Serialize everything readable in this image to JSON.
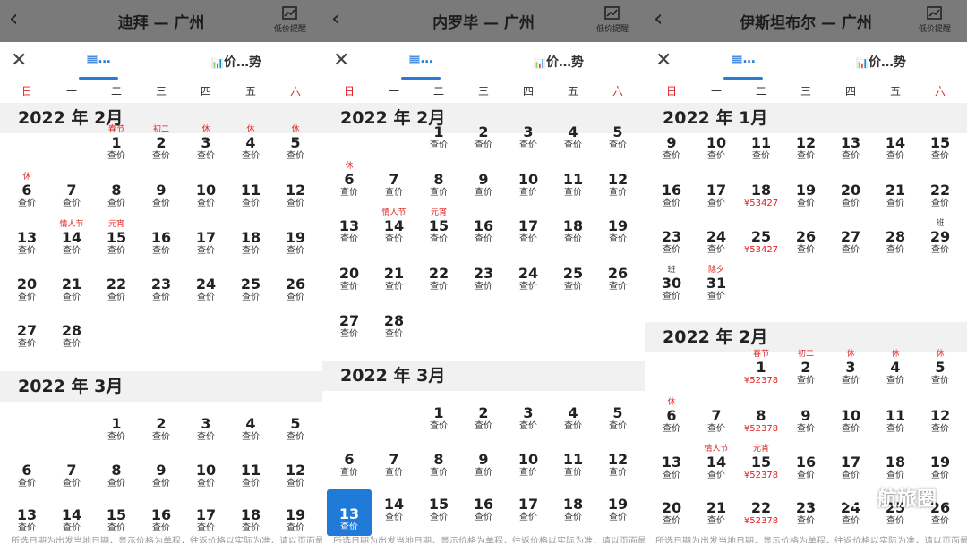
{
  "alert_label": "低价提醒",
  "tab_trend_label": "价…势",
  "weekdays": [
    "日",
    "一",
    "二",
    "三",
    "四",
    "五",
    "六"
  ],
  "footer_note": "所选日期为出发当地日期，显示价格为单程，往返价格以实际为准，请以页面最终价格为准",
  "watermark": "航旅圈",
  "panels": [
    {
      "route": "迪拜 — 广州",
      "months": [
        {
          "label": "2022 年 2月",
          "days": [
            {
              "d": "1",
              "hol": "春节",
              "p": "查价"
            },
            {
              "d": "2",
              "hol": "初二",
              "p": "查价"
            },
            {
              "d": "3",
              "hol": "休",
              "p": "查价"
            },
            {
              "d": "4",
              "hol": "休",
              "p": "查价"
            },
            {
              "d": "5",
              "hol": "休",
              "p": "查价"
            },
            {
              "d": "6",
              "hol": "休",
              "p": "查价"
            },
            {
              "d": "7",
              "p": "查价"
            },
            {
              "d": "8",
              "p": "查价"
            },
            {
              "d": "9",
              "p": "查价"
            },
            {
              "d": "10",
              "p": "查价"
            },
            {
              "d": "11",
              "p": "查价"
            },
            {
              "d": "12",
              "p": "查价"
            },
            {
              "d": "13",
              "p": "查价"
            },
            {
              "d": "14",
              "hol": "情人节",
              "p": "查价"
            },
            {
              "d": "15",
              "hol": "元宵",
              "p": "查价"
            },
            {
              "d": "16",
              "p": "查价"
            },
            {
              "d": "17",
              "p": "查价"
            },
            {
              "d": "18",
              "p": "查价"
            },
            {
              "d": "19",
              "p": "查价"
            },
            {
              "d": "20",
              "p": "查价"
            },
            {
              "d": "21",
              "p": "查价"
            },
            {
              "d": "22",
              "p": "查价"
            },
            {
              "d": "23",
              "p": "查价"
            },
            {
              "d": "24",
              "p": "查价"
            },
            {
              "d": "25",
              "p": "查价"
            },
            {
              "d": "26",
              "p": "查价"
            },
            {
              "d": "27",
              "p": "查价"
            },
            {
              "d": "28",
              "p": "查价"
            }
          ]
        },
        {
          "label": "2022 年 3月",
          "days": [
            {
              "d": "1",
              "p": "查价"
            },
            {
              "d": "2",
              "p": "查价"
            },
            {
              "d": "3",
              "p": "查价"
            },
            {
              "d": "4",
              "p": "查价"
            },
            {
              "d": "5",
              "p": "查价"
            },
            {
              "d": "6",
              "p": "查价"
            },
            {
              "d": "7",
              "p": "查价"
            },
            {
              "d": "8",
              "p": "查价"
            },
            {
              "d": "9",
              "p": "查价"
            },
            {
              "d": "10",
              "p": "查价"
            },
            {
              "d": "11",
              "p": "查价"
            },
            {
              "d": "12",
              "p": "查价"
            },
            {
              "d": "13",
              "p": "查价"
            },
            {
              "d": "14",
              "p": "查价"
            },
            {
              "d": "15",
              "p": "查价"
            },
            {
              "d": "16",
              "p": "查价"
            },
            {
              "d": "17",
              "p": "查价"
            },
            {
              "d": "18",
              "p": "查价"
            },
            {
              "d": "19",
              "p": "查价"
            }
          ]
        }
      ]
    },
    {
      "route": "内罗毕 — 广州",
      "months": [
        {
          "label": "2022 年 2月",
          "days": [
            {
              "d": "1",
              "p": "查价"
            },
            {
              "d": "2",
              "p": "查价"
            },
            {
              "d": "3",
              "p": "查价"
            },
            {
              "d": "4",
              "p": "查价"
            },
            {
              "d": "5",
              "p": "查价"
            },
            {
              "d": "6",
              "hol": "休",
              "p": "查价"
            },
            {
              "d": "7",
              "p": "查价"
            },
            {
              "d": "8",
              "p": "查价"
            },
            {
              "d": "9",
              "p": "查价"
            },
            {
              "d": "10",
              "p": "查价"
            },
            {
              "d": "11",
              "p": "查价"
            },
            {
              "d": "12",
              "p": "查价"
            },
            {
              "d": "13",
              "p": "查价"
            },
            {
              "d": "14",
              "hol": "情人节",
              "p": "查价"
            },
            {
              "d": "15",
              "hol": "元宵",
              "p": "查价"
            },
            {
              "d": "16",
              "p": "查价"
            },
            {
              "d": "17",
              "p": "查价"
            },
            {
              "d": "18",
              "p": "查价"
            },
            {
              "d": "19",
              "p": "查价"
            },
            {
              "d": "20",
              "p": "查价"
            },
            {
              "d": "21",
              "p": "查价"
            },
            {
              "d": "22",
              "p": "查价"
            },
            {
              "d": "23",
              "p": "查价"
            },
            {
              "d": "24",
              "p": "查价"
            },
            {
              "d": "25",
              "p": "查价"
            },
            {
              "d": "26",
              "p": "查价"
            },
            {
              "d": "27",
              "p": "查价"
            },
            {
              "d": "28",
              "p": "查价"
            }
          ]
        },
        {
          "label": "2022 年 3月",
          "days": [
            {
              "d": "1",
              "p": "查价"
            },
            {
              "d": "2",
              "p": "查价"
            },
            {
              "d": "3",
              "p": "查价"
            },
            {
              "d": "4",
              "p": "查价"
            },
            {
              "d": "5",
              "p": "查价"
            },
            {
              "d": "6",
              "p": "查价"
            },
            {
              "d": "7",
              "p": "查价"
            },
            {
              "d": "8",
              "p": "查价"
            },
            {
              "d": "9",
              "p": "查价"
            },
            {
              "d": "10",
              "p": "查价"
            },
            {
              "d": "11",
              "p": "查价"
            },
            {
              "d": "12",
              "p": "查价"
            },
            {
              "d": "13",
              "p": "查价",
              "selected": true
            },
            {
              "d": "14",
              "p": "查价"
            },
            {
              "d": "15",
              "p": "查价"
            },
            {
              "d": "16",
              "p": "查价"
            },
            {
              "d": "17",
              "p": "查价"
            },
            {
              "d": "18",
              "p": "查价"
            },
            {
              "d": "19",
              "p": "查价"
            }
          ]
        }
      ]
    },
    {
      "route": "伊斯坦布尔 — 广州",
      "months": [
        {
          "label": "2022 年 1月",
          "days": [
            {
              "d": "9",
              "p": "查价"
            },
            {
              "d": "10",
              "p": "查价"
            },
            {
              "d": "11",
              "p": "查价"
            },
            {
              "d": "12",
              "p": "查价"
            },
            {
              "d": "13",
              "p": "查价"
            },
            {
              "d": "14",
              "p": "查价"
            },
            {
              "d": "15",
              "p": "查价"
            },
            {
              "d": "16",
              "p": "查价"
            },
            {
              "d": "17",
              "p": "查价"
            },
            {
              "d": "18",
              "p": "¥53427",
              "red": true
            },
            {
              "d": "19",
              "p": "查价"
            },
            {
              "d": "20",
              "p": "查价"
            },
            {
              "d": "21",
              "p": "查价"
            },
            {
              "d": "22",
              "p": "查价"
            },
            {
              "d": "23",
              "p": "查价"
            },
            {
              "d": "24",
              "p": "查价"
            },
            {
              "d": "25",
              "p": "¥53427",
              "red": true
            },
            {
              "d": "26",
              "p": "查价"
            },
            {
              "d": "27",
              "p": "查价"
            },
            {
              "d": "28",
              "p": "查价"
            },
            {
              "d": "29",
              "hol": "班",
              "gray": true,
              "p": "查价"
            },
            {
              "d": "30",
              "hol": "班",
              "gray": true,
              "p": "查价"
            },
            {
              "d": "31",
              "hol": "除夕",
              "p": "查价"
            }
          ]
        },
        {
          "label": "2022 年 2月",
          "days": [
            {
              "d": "1",
              "hol": "春节",
              "p": "¥52378",
              "red": true
            },
            {
              "d": "2",
              "hol": "初二",
              "p": "查价"
            },
            {
              "d": "3",
              "hol": "休",
              "p": "查价"
            },
            {
              "d": "4",
              "hol": "休",
              "p": "查价"
            },
            {
              "d": "5",
              "hol": "休",
              "p": "查价"
            },
            {
              "d": "6",
              "hol": "休",
              "p": "查价"
            },
            {
              "d": "7",
              "p": "查价"
            },
            {
              "d": "8",
              "p": "¥52378",
              "red": true
            },
            {
              "d": "9",
              "p": "查价"
            },
            {
              "d": "10",
              "p": "查价"
            },
            {
              "d": "11",
              "p": "查价"
            },
            {
              "d": "12",
              "p": "查价"
            },
            {
              "d": "13",
              "p": "查价"
            },
            {
              "d": "14",
              "hol": "情人节",
              "p": "查价"
            },
            {
              "d": "15",
              "p": "¥52378",
              "hol": "元宵",
              "red": true
            },
            {
              "d": "16",
              "p": "查价"
            },
            {
              "d": "17",
              "p": "查价"
            },
            {
              "d": "18",
              "p": "查价"
            },
            {
              "d": "19",
              "p": "查价"
            },
            {
              "d": "20",
              "p": "查价"
            },
            {
              "d": "21",
              "p": "查价"
            },
            {
              "d": "22",
              "p": "¥52378",
              "red": true
            },
            {
              "d": "23",
              "p": "查价"
            },
            {
              "d": "24",
              "p": "查价"
            },
            {
              "d": "25",
              "p": "查价"
            },
            {
              "d": "26",
              "p": "查价"
            }
          ]
        }
      ]
    }
  ]
}
